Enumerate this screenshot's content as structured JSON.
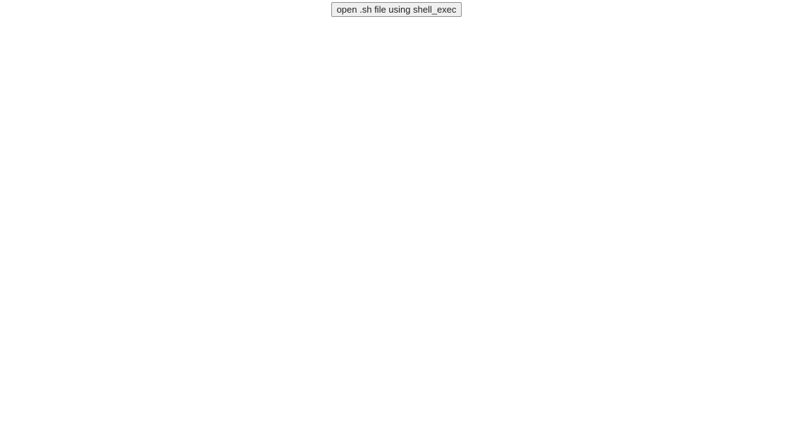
{
  "main": {
    "button_label": "open .sh file using shell_exec"
  }
}
